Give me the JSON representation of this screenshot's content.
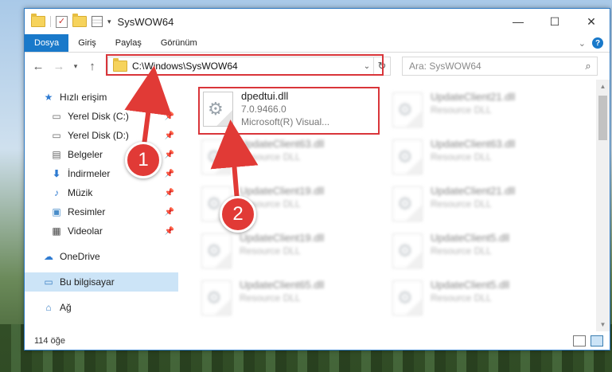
{
  "window": {
    "title": "SysWOW64",
    "controls": {
      "minimize": "—",
      "maximize": "☐",
      "close": "✕"
    }
  },
  "ribbon": {
    "tabs": [
      "Dosya",
      "Giriş",
      "Paylaş",
      "Görünüm"
    ],
    "help": "?"
  },
  "nav": {
    "address": "C:\\Windows\\SysWOW64",
    "search_placeholder": "Ara: SysWOW64"
  },
  "sidebar": {
    "quick_access": "Hızlı erişim",
    "items": [
      {
        "label": "Yerel Disk (C:)",
        "icon": "drive-icon"
      },
      {
        "label": "Yerel Disk (D:)",
        "icon": "drive-icon"
      },
      {
        "label": "Belgeler",
        "icon": "documents-icon"
      },
      {
        "label": "İndirmeler",
        "icon": "downloads-icon"
      },
      {
        "label": "Müzik",
        "icon": "music-icon"
      },
      {
        "label": "Resimler",
        "icon": "pictures-icon"
      },
      {
        "label": "Videolar",
        "icon": "videos-icon"
      }
    ],
    "onedrive": "OneDrive",
    "this_pc": "Bu bilgisayar",
    "network": "Ağ"
  },
  "files": {
    "main": {
      "name": "dpedtui.dll",
      "version": "7.0.9466.0",
      "company": "Microsoft(R) Visual..."
    },
    "left": [
      {
        "name": "UpdateClient63.dll",
        "desc": "Resource DLL"
      },
      {
        "name": "UpdateClient19.dll",
        "desc": "Resource DLL"
      },
      {
        "name": "UpdateClient19.dll",
        "desc": "Resource DLL"
      },
      {
        "name": "UpdateClient65.dll",
        "desc": "Resource DLL"
      }
    ],
    "right": [
      {
        "name": "UpdateClient21.dll",
        "desc": "Resource DLL"
      },
      {
        "name": "UpdateClient63.dll",
        "desc": "Resource DLL"
      },
      {
        "name": "UpdateClient21.dll",
        "desc": "Resource DLL"
      },
      {
        "name": "UpdateClient5.dll",
        "desc": "Resource DLL"
      },
      {
        "name": "UpdateClient5.dll",
        "desc": "Resource DLL"
      }
    ]
  },
  "status": {
    "count": "114 öğe"
  },
  "annotations": {
    "step1": "1",
    "step2": "2"
  },
  "colors": {
    "accent": "#1979ca",
    "highlight": "#d9353a",
    "selection": "#cce4f7"
  }
}
